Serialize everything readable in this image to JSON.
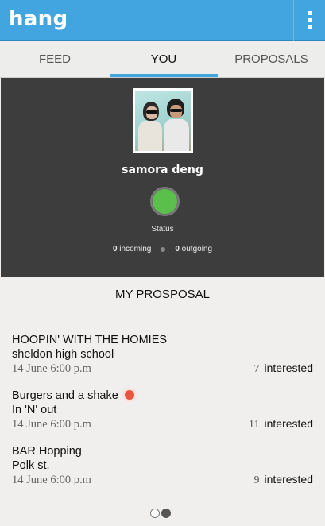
{
  "app": {
    "title": "hang",
    "menu_icon": "overflow-menu-icon"
  },
  "tabs": [
    {
      "label": "FEED",
      "active": false
    },
    {
      "label": "YOU",
      "active": true
    },
    {
      "label": "PROPOSALS",
      "active": false
    }
  ],
  "profile": {
    "name": "samora deng",
    "status_label": "Status",
    "status_color": "#5bbf4b",
    "incoming_count": "0",
    "incoming_label": "incoming",
    "outgoing_count": "0",
    "outgoing_label": "outgoing"
  },
  "proposals_section": {
    "title": "MY PROSPOSAL",
    "items": [
      {
        "title": "HOOPIN' WITH THE HOMIES",
        "place": "sheldon high school",
        "date": "14 June 6:00 p.m",
        "count": "7",
        "count_label": "interested",
        "highlight": false
      },
      {
        "title": "Burgers and a shake",
        "place": "In 'N' out",
        "date": "14 June 6:00 p.m",
        "count": "11",
        "count_label": "interested",
        "highlight": true
      },
      {
        "title": "BAR Hopping",
        "place": "Polk st.",
        "date": "14 June 6:00 p.m",
        "count": "9",
        "count_label": "interested",
        "highlight": false
      }
    ]
  },
  "pager": {
    "pages": 2,
    "current": 2
  },
  "colors": {
    "accent": "#42a5e0",
    "dark_panel": "#3d3d3d",
    "alert": "#e8543e"
  }
}
